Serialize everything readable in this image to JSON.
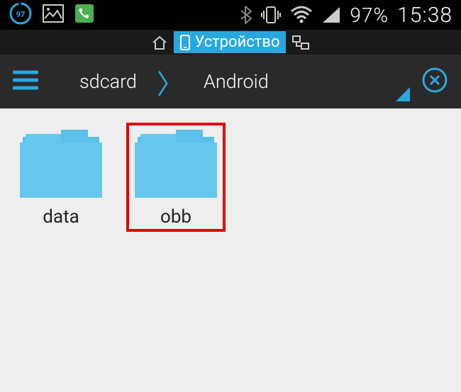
{
  "status": {
    "battery": "97%",
    "time": "15:38",
    "notification_badge": "97"
  },
  "tabs": {
    "device_label": "Устройство"
  },
  "path": {
    "segment1": "sdcard",
    "segment2": "Android"
  },
  "folders": [
    {
      "name": "data",
      "highlighted": false
    },
    {
      "name": "obb",
      "highlighted": true
    }
  ],
  "colors": {
    "accent": "#29a8e0",
    "highlight_border": "#e80000"
  }
}
